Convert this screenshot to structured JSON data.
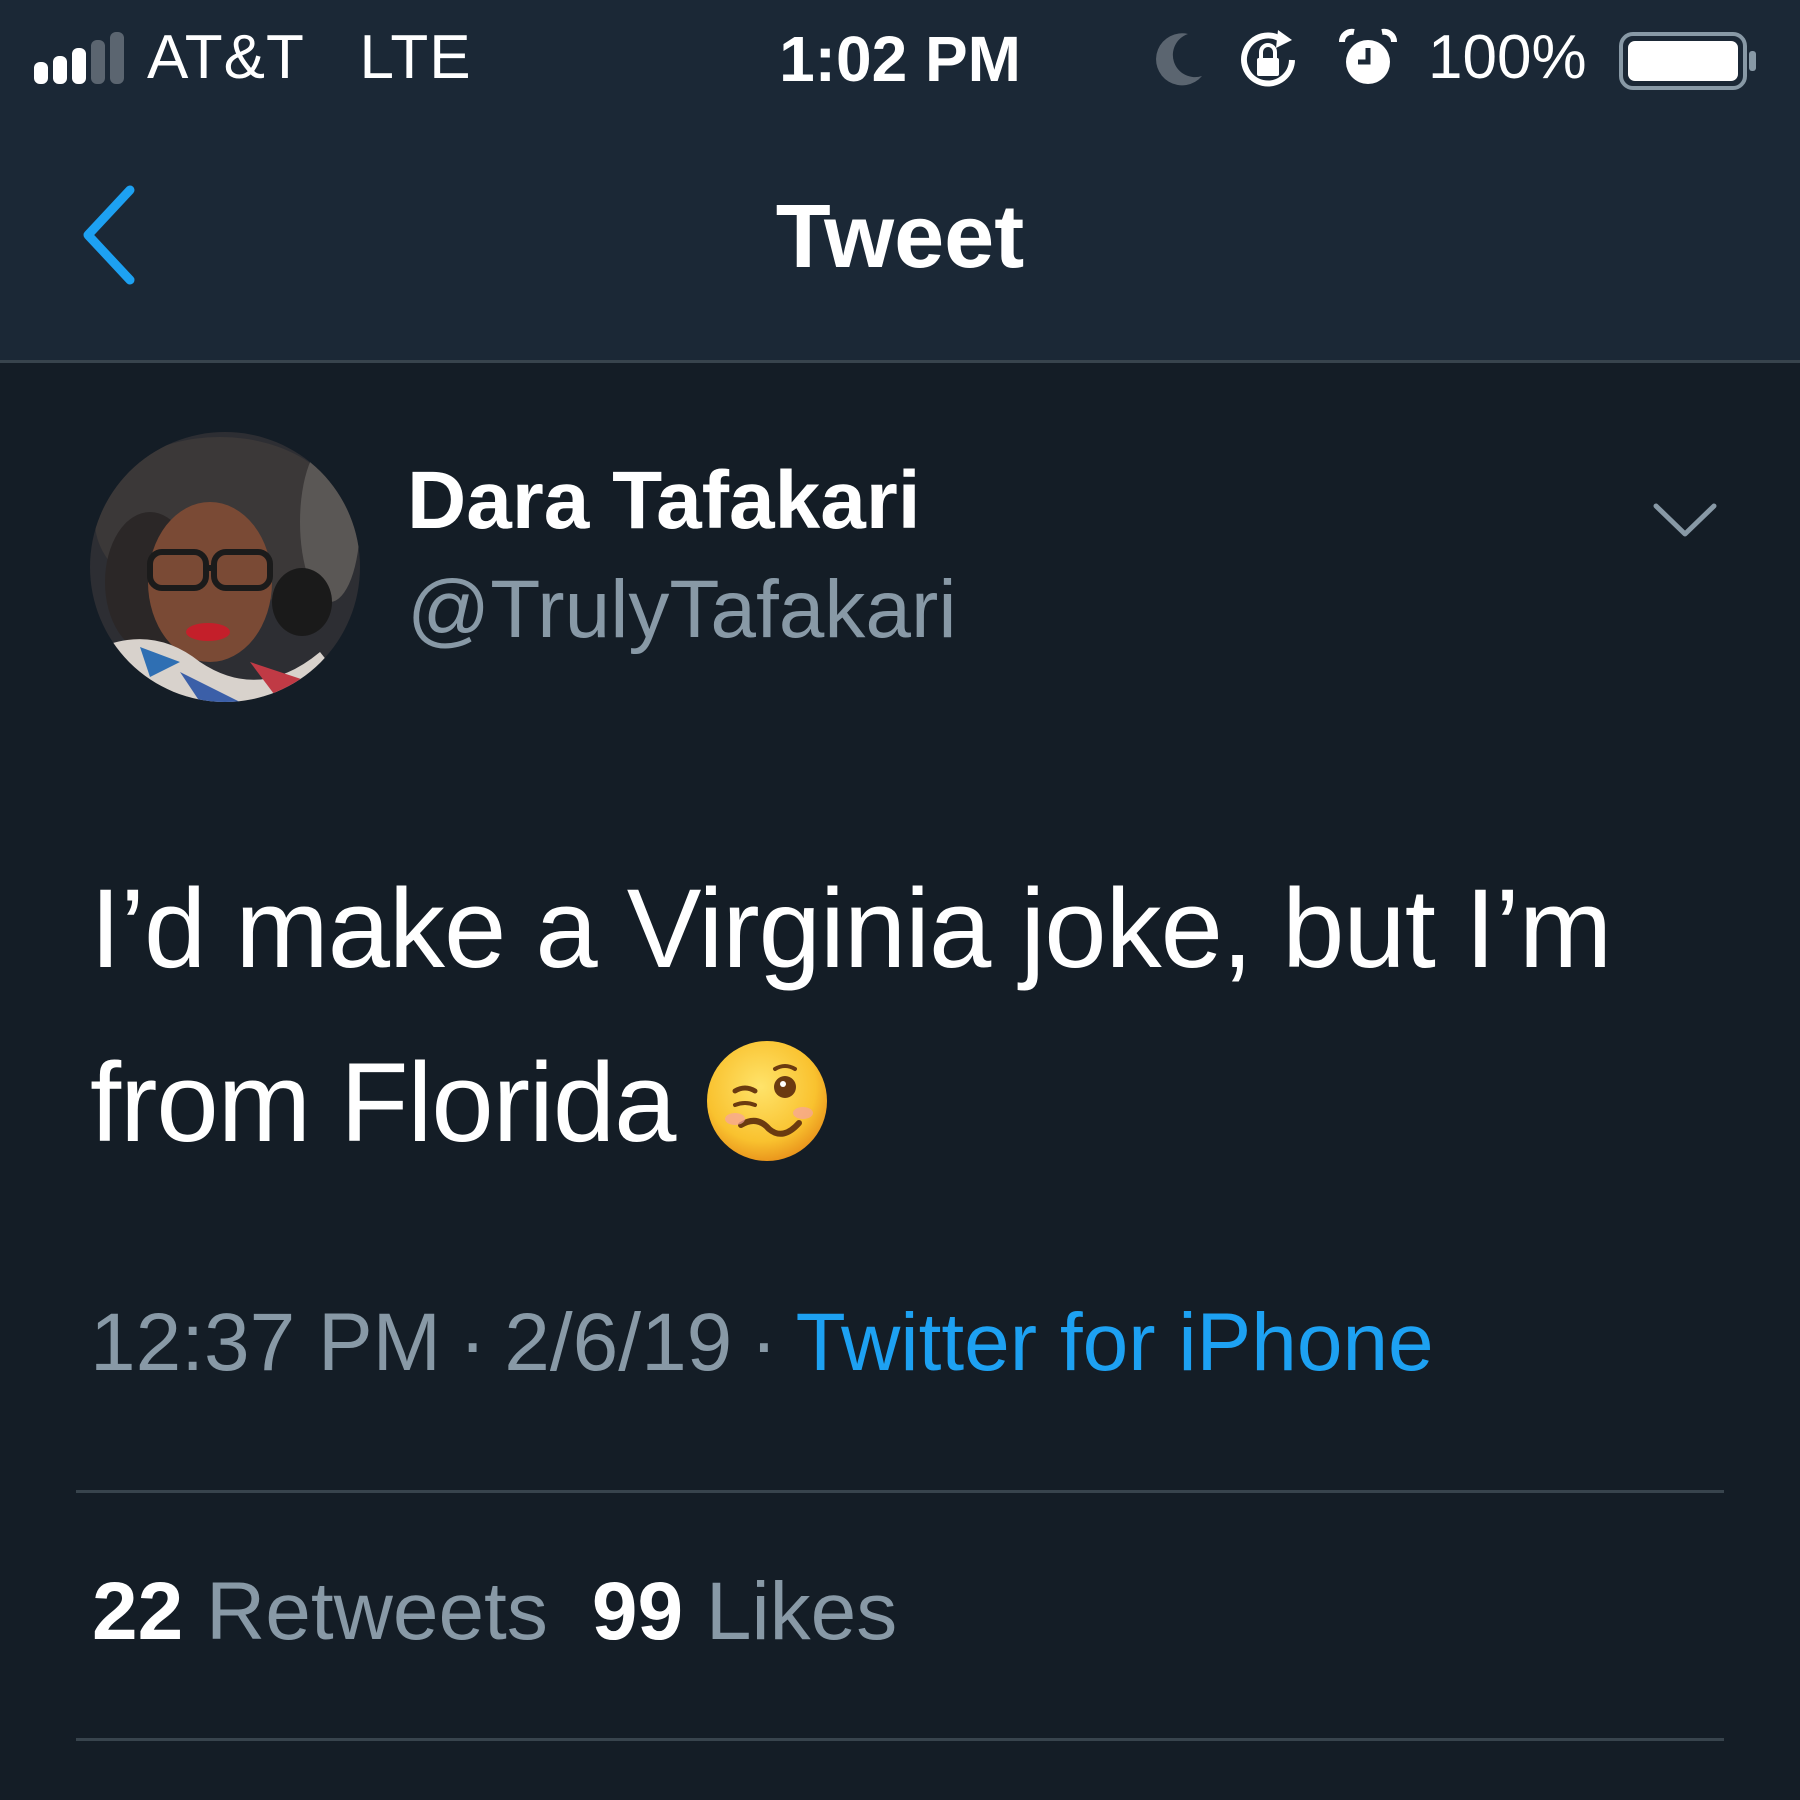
{
  "status_bar": {
    "carrier": "AT&T",
    "network": "LTE",
    "time": "1:02 PM",
    "battery_percent": "100%",
    "signal_bars_filled": 3,
    "signal_bars_total": 5,
    "icons": [
      "signal-icon",
      "moon-icon",
      "rotation-lock-icon",
      "alarm-icon",
      "battery-icon"
    ]
  },
  "nav": {
    "back_icon": "chevron-left-icon",
    "title": "Tweet"
  },
  "tweet": {
    "author_name": "Dara Tafakari",
    "author_handle": "@TrulyTafakari",
    "menu_icon": "chevron-down-icon",
    "text_line_1": "I’d make a Virginia joke, but I’m",
    "text_line_2": "from Florida",
    "emoji": "woozy-face-emoji",
    "time": "12:37 PM",
    "separator": "·",
    "date": "2/6/19",
    "source": "Twitter for iPhone",
    "retweets_count": "22",
    "retweets_label": "Retweets",
    "likes_count": "99",
    "likes_label": "Likes"
  },
  "colors": {
    "background": "#141d26",
    "header_background": "#1b2836",
    "accent": "#1da1f2",
    "secondary_text": "#8899a6",
    "divider": "#38444d"
  }
}
